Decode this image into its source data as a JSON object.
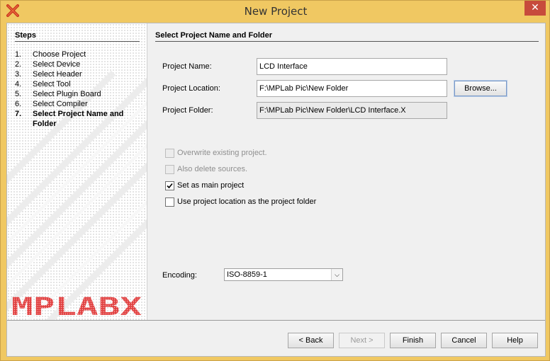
{
  "window": {
    "title": "New Project",
    "app_icon": "x-logo-icon",
    "close_glyph": "✕"
  },
  "steps": {
    "heading": "Steps",
    "items": [
      {
        "num": "1.",
        "label": "Choose Project"
      },
      {
        "num": "2.",
        "label": "Select Device"
      },
      {
        "num": "3.",
        "label": "Select Header"
      },
      {
        "num": "4.",
        "label": "Select Tool"
      },
      {
        "num": "5.",
        "label": "Select Plugin Board"
      },
      {
        "num": "6.",
        "label": "Select Compiler"
      },
      {
        "num": "7.",
        "label": "Select Project Name and Folder",
        "current": true
      }
    ],
    "logo_text": "MPLABX"
  },
  "main": {
    "heading": "Select Project Name and Folder",
    "project_name": {
      "label": "Project Name:",
      "value": "LCD Interface"
    },
    "project_location": {
      "label": "Project Location:",
      "value": "F:\\MPLab Pic\\New Folder"
    },
    "project_folder": {
      "label": "Project Folder:",
      "value": "F:\\MPLab Pic\\New Folder\\LCD Interface.X"
    },
    "browse_label": "Browse...",
    "options": [
      {
        "label": "Overwrite existing project.",
        "checked": false,
        "enabled": false
      },
      {
        "label": "Also delete sources.",
        "checked": false,
        "enabled": false
      },
      {
        "label": "Set as main project",
        "checked": true,
        "enabled": true
      },
      {
        "label": "Use project location as the project folder",
        "checked": false,
        "enabled": true
      }
    ],
    "encoding": {
      "label": "Encoding:",
      "value": "ISO-8859-1"
    }
  },
  "buttons": {
    "back": "< Back",
    "next": "Next >",
    "finish": "Finish",
    "cancel": "Cancel",
    "help": "Help"
  },
  "colors": {
    "titlebar": "#f0c862",
    "close": "#c74b3c",
    "logo": "#e04040"
  }
}
